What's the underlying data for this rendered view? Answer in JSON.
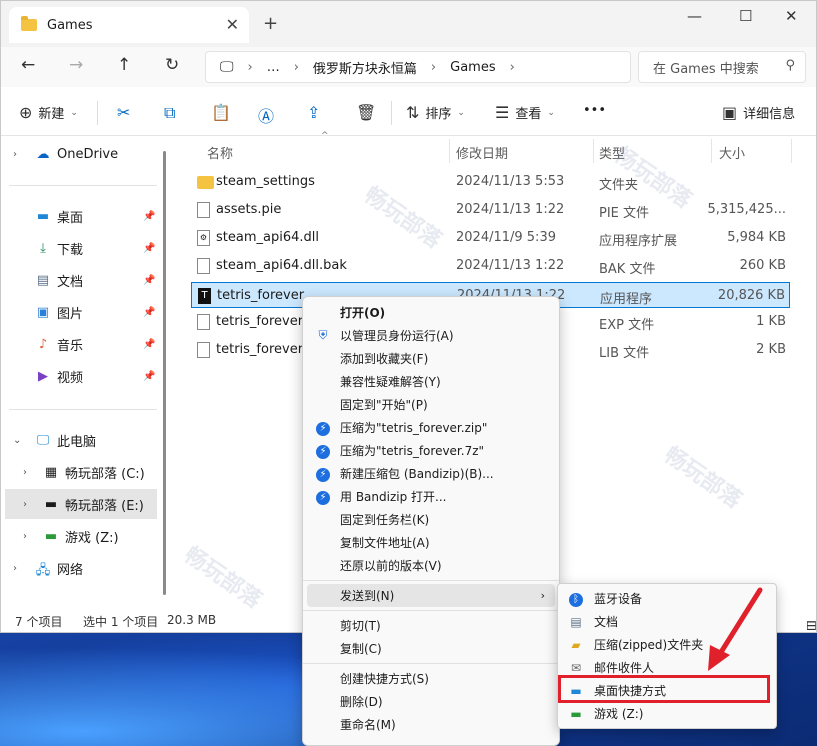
{
  "window": {
    "tab_title": "Games",
    "tab_close": "✕",
    "tab_add": "+",
    "controls": {
      "minimize": "—",
      "maximize": "☐",
      "close": "✕"
    }
  },
  "addressbar": {
    "crumbs": [
      "…",
      "俄罗斯方块永恒篇",
      "Games"
    ],
    "search_placeholder": "在 Games 中搜索"
  },
  "toolbar": {
    "new_label": "新建",
    "sort_label": "排序",
    "view_label": "查看",
    "more_label": "•••",
    "details_label": "详细信息"
  },
  "sidebar": {
    "onedrive": "OneDrive",
    "quick": [
      {
        "label": "桌面",
        "icon": "desktop-icon"
      },
      {
        "label": "下载",
        "icon": "download-icon"
      },
      {
        "label": "文档",
        "icon": "document-icon"
      },
      {
        "label": "图片",
        "icon": "pictures-icon"
      },
      {
        "label": "音乐",
        "icon": "music-icon"
      },
      {
        "label": "视频",
        "icon": "video-icon"
      }
    ],
    "this_pc": "此电脑",
    "drives": [
      {
        "label": "畅玩部落 (C:)"
      },
      {
        "label": "畅玩部落 (E:)"
      },
      {
        "label": "游戏 (Z:)"
      }
    ],
    "network": "网络"
  },
  "table": {
    "headers": [
      "名称",
      "修改日期",
      "类型",
      "大小"
    ],
    "rows": [
      {
        "name": "steam_settings",
        "date": "2024/11/13 5:53",
        "type": "文件夹",
        "size": "",
        "icon": "folder-icon"
      },
      {
        "name": "assets.pie",
        "date": "2024/11/13 1:22",
        "type": "PIE 文件",
        "size": "5,315,425...",
        "icon": "file-icon"
      },
      {
        "name": "steam_api64.dll",
        "date": "2024/11/9 5:39",
        "type": "应用程序扩展",
        "size": "5,984 KB",
        "icon": "dll-icon"
      },
      {
        "name": "steam_api64.dll.bak",
        "date": "2024/11/13 1:22",
        "type": "BAK 文件",
        "size": "260 KB",
        "icon": "file-icon"
      },
      {
        "name": "tetris_forever",
        "date": "2024/11/13 1:22",
        "type": "应用程序",
        "size": "20,826 KB",
        "icon": "exe-icon"
      },
      {
        "name": "tetris_forever.exp",
        "date": "",
        "type": "EXP 文件",
        "size": "1 KB",
        "icon": "file-icon"
      },
      {
        "name": "tetris_forever.lib",
        "date": "",
        "type": "LIB 文件",
        "size": "2 KB",
        "icon": "file-icon"
      }
    ]
  },
  "statusbar": {
    "count": "7 个项目",
    "selected": "选中 1 个项目",
    "size": "20.3 MB"
  },
  "context_menu": {
    "items": [
      {
        "label": "打开(O)"
      },
      {
        "label": "以管理员身份运行(A)"
      },
      {
        "label": "添加到收藏夹(F)"
      },
      {
        "label": "兼容性疑难解答(Y)"
      },
      {
        "label": "固定到\"开始\"(P)"
      },
      {
        "label": "压缩为\"tetris_forever.zip\""
      },
      {
        "label": "压缩为\"tetris_forever.7z\""
      },
      {
        "label": "新建压缩包 (Bandizip)(B)..."
      },
      {
        "label": "用 Bandizip 打开..."
      },
      {
        "label": "固定到任务栏(K)"
      },
      {
        "label": "复制文件地址(A)"
      },
      {
        "label": "还原以前的版本(V)"
      },
      {
        "label": "发送到(N)"
      },
      {
        "label": "剪切(T)"
      },
      {
        "label": "复制(C)"
      },
      {
        "label": "创建快捷方式(S)"
      },
      {
        "label": "删除(D)"
      },
      {
        "label": "重命名(M)"
      }
    ]
  },
  "send_to_menu": {
    "items": [
      {
        "label": "蓝牙设备",
        "icon": "bluetooth-icon"
      },
      {
        "label": "文档",
        "icon": "document-icon"
      },
      {
        "label": "压缩(zipped)文件夹",
        "icon": "zip-folder-icon"
      },
      {
        "label": "邮件收件人",
        "icon": "mail-icon"
      },
      {
        "label": "桌面快捷方式",
        "icon": "desktop-icon"
      },
      {
        "label": "游戏 (Z:)",
        "icon": "drive-icon"
      }
    ]
  },
  "watermark_text": "畅玩部落",
  "colors": {
    "accent": "#0067c0",
    "selection": "#cce8ff",
    "highlight_box": "#e0202a"
  }
}
